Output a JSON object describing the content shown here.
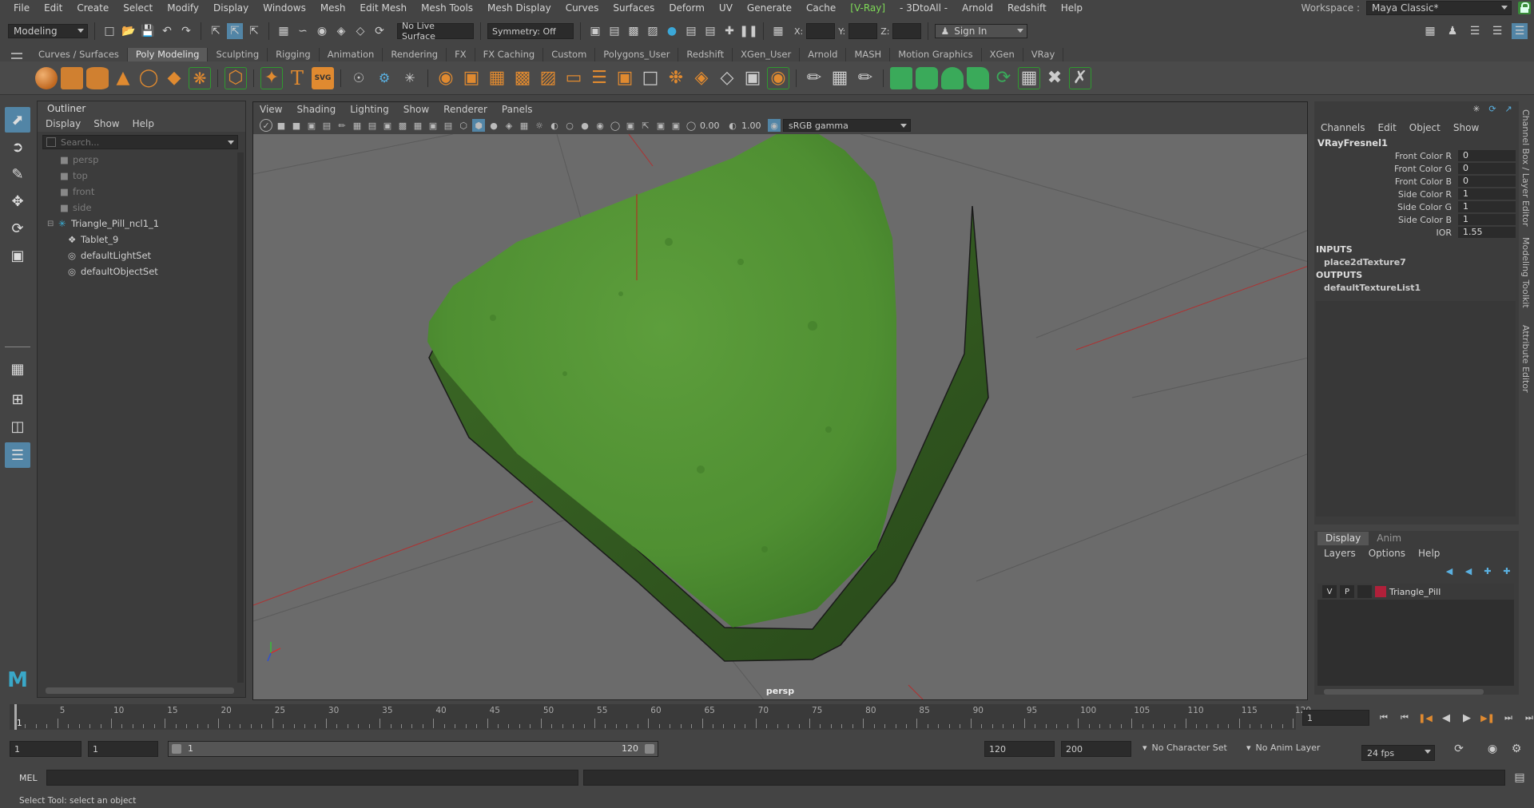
{
  "menubar": {
    "items": [
      "File",
      "Edit",
      "Create",
      "Select",
      "Modify",
      "Display",
      "Windows",
      "Mesh",
      "Edit Mesh",
      "Mesh Tools",
      "Mesh Display",
      "Curves",
      "Surfaces",
      "Deform",
      "UV",
      "Generate",
      "Cache",
      "[V-Ray]",
      "- 3DtoAll -",
      "Arnold",
      "Redshift",
      "Help"
    ],
    "workspace_label": "Workspace :",
    "workspace_value": "Maya Classic*"
  },
  "statusline": {
    "mode": "Modeling",
    "live_surface": "No Live Surface",
    "symmetry": "Symmetry: Off",
    "x_label": "X:",
    "y_label": "Y:",
    "z_label": "Z:",
    "sign_in": "Sign In"
  },
  "shelf": {
    "tabs": [
      "Curves / Surfaces",
      "Poly Modeling",
      "Sculpting",
      "Rigging",
      "Animation",
      "Rendering",
      "FX",
      "FX Caching",
      "Custom",
      "Polygons_User",
      "Redshift",
      "XGen_User",
      "Arnold",
      "MASH",
      "Motion Graphics",
      "XGen",
      "VRay"
    ],
    "active_tab": "Poly Modeling",
    "text_icon": "T",
    "svg_icon": "SVG"
  },
  "outliner": {
    "title": "Outliner",
    "menus": [
      "Display",
      "Show",
      "Help"
    ],
    "search_placeholder": "Search...",
    "items": [
      {
        "label": "persp",
        "dim": true
      },
      {
        "label": "top",
        "dim": true
      },
      {
        "label": "front",
        "dim": true
      },
      {
        "label": "side",
        "dim": true
      },
      {
        "label": "Triangle_Pill_ncl1_1",
        "dim": false
      },
      {
        "label": "Tablet_9",
        "dim": false
      },
      {
        "label": "defaultLightSet",
        "dim": false
      },
      {
        "label": "defaultObjectSet",
        "dim": false
      }
    ]
  },
  "viewport": {
    "menus": [
      "View",
      "Shading",
      "Lighting",
      "Show",
      "Renderer",
      "Panels"
    ],
    "field_a": "0.00",
    "field_b": "1.00",
    "color_space": "sRGB gamma",
    "camera_label": "persp",
    "object_color": "#5a9a3a"
  },
  "channelbox": {
    "menus": [
      "Channels",
      "Edit",
      "Object",
      "Show"
    ],
    "node": "VRayFresnel1",
    "attributes": [
      {
        "name": "Front Color R",
        "value": "0"
      },
      {
        "name": "Front Color G",
        "value": "0"
      },
      {
        "name": "Front Color B",
        "value": "0"
      },
      {
        "name": "Side Color R",
        "value": "1"
      },
      {
        "name": "Side Color G",
        "value": "1"
      },
      {
        "name": "Side Color B",
        "value": "1"
      },
      {
        "name": "IOR",
        "value": "1.55"
      }
    ],
    "inputs_label": "INPUTS",
    "input_node": "place2dTexture7",
    "outputs_label": "OUTPUTS",
    "output_node": "defaultTextureList1"
  },
  "sidetabs": [
    "Channel Box / Layer Editor",
    "Modeling Toolkit",
    "Attribute Editor"
  ],
  "layereditor": {
    "tabs": [
      "Display",
      "Anim"
    ],
    "menus": [
      "Layers",
      "Options",
      "Help"
    ],
    "layer": {
      "v": "V",
      "p": "P",
      "name": "Triangle_Pill",
      "color": "#b0203a"
    }
  },
  "timeline": {
    "ticks": [
      1,
      5,
      10,
      15,
      20,
      25,
      30,
      35,
      40,
      45,
      50,
      55,
      60,
      65,
      70,
      75,
      80,
      85,
      90,
      95,
      100,
      105,
      110,
      115,
      120
    ],
    "current_frame": "1"
  },
  "range": {
    "start": "1",
    "anim_start": "1",
    "range_start": "1",
    "range_end": "120",
    "end": "120",
    "anim_end": "200",
    "character_set": "No Character Set",
    "anim_layer": "No Anim Layer",
    "fps": "24 fps"
  },
  "cmdline": {
    "label": "MEL"
  },
  "helpline": {
    "text": "Select Tool: select an object"
  }
}
